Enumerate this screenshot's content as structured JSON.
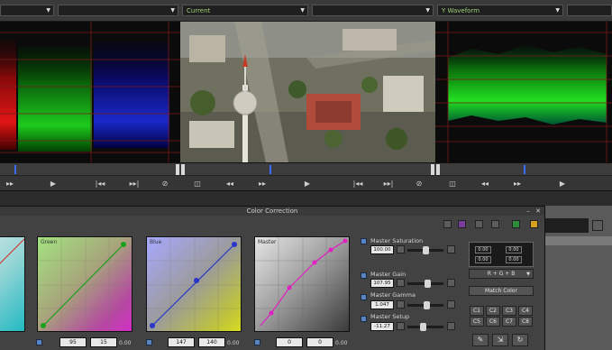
{
  "headers": {
    "source_dropdown": "",
    "current_dropdown": "Current",
    "waveform_dropdown": "Y Waveform",
    "left_blank": "",
    "mid_blank": "",
    "right_blank": ""
  },
  "panel": {
    "title": "Color Correction"
  },
  "curves": {
    "red_label": "",
    "green_label": "Green",
    "blue_label": "Blue",
    "master_label": "Master",
    "green_in": "95",
    "green_out": "15",
    "blue_in": "147",
    "blue_out": "140",
    "master_in": "0",
    "master_out": "0",
    "readout": "0.00"
  },
  "master": {
    "saturation_label": "Master Saturation",
    "saturation_value": "100.00",
    "gain_label": "Master Gain",
    "gain_value": "107.95",
    "gamma_label": "Master Gamma",
    "gamma_value": "1.047",
    "setup_label": "Master Setup",
    "setup_value": "-11.27"
  },
  "rgb": {
    "r_top": "0.00",
    "r_bot": "0.00",
    "g_top": "0.00",
    "g_bot": "0.00",
    "mode": "R + G + B",
    "match_label": "Match Color"
  },
  "color_buttons": [
    "C1",
    "C2",
    "C3",
    "C4",
    "C5",
    "C6",
    "C7",
    "C8"
  ],
  "colors": {
    "accent_green": "#9fd27a",
    "scope_green": "#19c819",
    "scope_blue": "#1a2bd4",
    "scope_red": "#d01515",
    "playhead": "#3a6cff"
  },
  "icons": [
    "play-icon",
    "rewind-icon",
    "fast-forward-icon",
    "step-back-icon",
    "step-forward-icon",
    "loop-icon",
    "dual-monitor-icon",
    "eyedropper-icon",
    "close-icon",
    "minimize-icon"
  ]
}
